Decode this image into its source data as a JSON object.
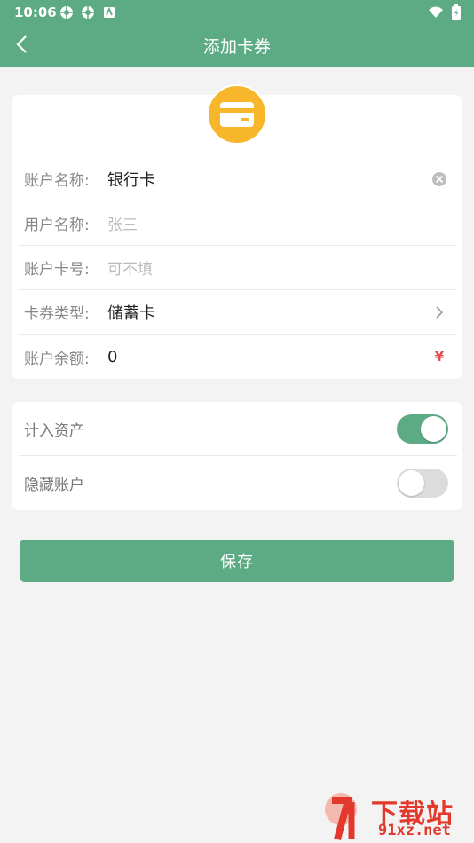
{
  "status_bar": {
    "time": "10:06"
  },
  "navbar": {
    "title": "添加卡券"
  },
  "form": {
    "rows": [
      {
        "label": "账户名称:",
        "value": "银行卡",
        "placeholder": ""
      },
      {
        "label": "用户名称:",
        "value": "",
        "placeholder": "张三"
      },
      {
        "label": "账户卡号:",
        "value": "",
        "placeholder": "可不填"
      },
      {
        "label": "卡券类型:",
        "value": "储蓄卡",
        "placeholder": ""
      },
      {
        "label": "账户余额:",
        "value": "0",
        "placeholder": ""
      }
    ],
    "currency_symbol": "¥"
  },
  "toggles": [
    {
      "label": "计入资产",
      "on": true
    },
    {
      "label": "隐藏账户",
      "on": false
    }
  ],
  "save_label": "保存",
  "watermark": {
    "text": "下载站",
    "url": "91xz.net"
  },
  "colors": {
    "brand": "#5dab85",
    "icon_bg": "#f8b62b",
    "accent_red": "#e24a4a"
  }
}
